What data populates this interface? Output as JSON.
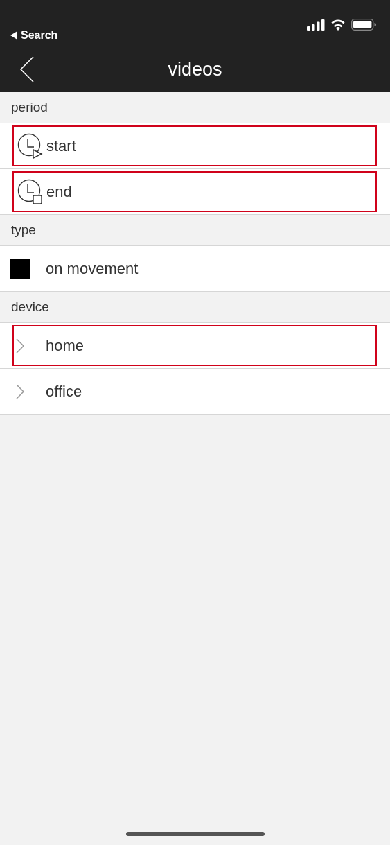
{
  "status_bar": {
    "back_link": "Search"
  },
  "nav_bar": {
    "title": "videos"
  },
  "sections": [
    {
      "header": "period",
      "rows": [
        {
          "kind": "clock-start",
          "label": "start",
          "highlighted": true
        },
        {
          "kind": "clock-end",
          "label": "end",
          "highlighted": true
        }
      ]
    },
    {
      "header": "type",
      "rows": [
        {
          "kind": "checkbox",
          "label": "on movement",
          "checked": true,
          "highlighted": false
        }
      ]
    },
    {
      "header": "device",
      "rows": [
        {
          "kind": "disclosure",
          "label": "home",
          "highlighted": true
        },
        {
          "kind": "disclosure",
          "label": "office",
          "highlighted": false
        }
      ]
    }
  ]
}
